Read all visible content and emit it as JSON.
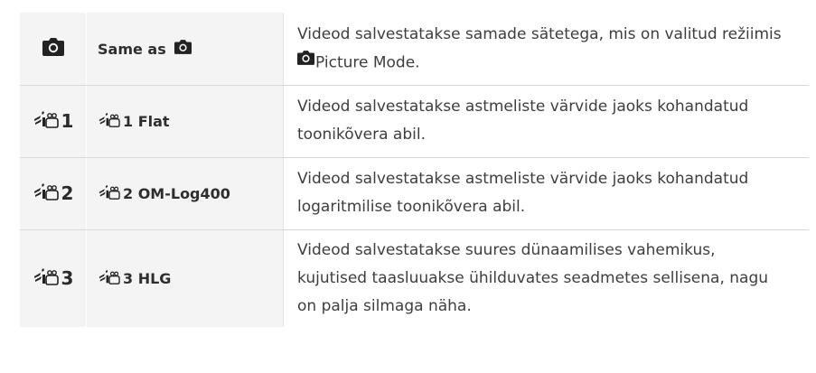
{
  "rows": [
    {
      "code_icon": "camera-icon",
      "code_text": "",
      "name_text": "Same as",
      "name_icon": "camera-icon",
      "desc_line1": "Videod salvestatakse samade sätetega, mis on valitud režiimis",
      "desc_icon": "camera-icon",
      "desc_line2": "Picture Mode."
    },
    {
      "code_icon": "video-profile-icon",
      "code_text": "1",
      "name_icon": "video-profile-icon",
      "name_text": "1 Flat",
      "desc_line1": "Videod salvestatakse astmeliste värvide jaoks kohandatud",
      "desc_line2": "toonikõvera abil."
    },
    {
      "code_icon": "video-profile-icon",
      "code_text": "2",
      "name_icon": "video-profile-icon",
      "name_text": "2 OM-Log400",
      "desc_line1": "Videod salvestatakse astmeliste värvide jaoks kohandatud",
      "desc_line2": "logaritmilise toonikõvera abil."
    },
    {
      "code_icon": "video-profile-icon",
      "code_text": "3",
      "name_icon": "video-profile-icon",
      "name_text": "3 HLG",
      "desc_line1": "Videod salvestatakse suures dünaamilises vahemikus,",
      "desc_line2": "kujutised taasluuakse ühilduvates seadmetes sellisena, nagu",
      "desc_line3": "on palja silmaga näha."
    }
  ]
}
